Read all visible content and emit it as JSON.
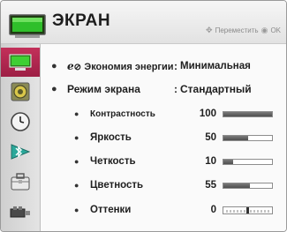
{
  "header": {
    "title": "ЭКРАН",
    "hint_move": "Переместить",
    "hint_ok": "OK"
  },
  "sidebar": {
    "items": [
      {
        "name": "picture",
        "icon": "monitor-icon",
        "active": true
      },
      {
        "name": "audio",
        "icon": "speaker-icon",
        "active": false
      },
      {
        "name": "time",
        "icon": "clock-icon",
        "active": false
      },
      {
        "name": "bluetooth",
        "icon": "bluetooth-icon",
        "active": false
      },
      {
        "name": "options",
        "icon": "briefcase-icon",
        "active": false
      },
      {
        "name": "input",
        "icon": "cable-icon",
        "active": false
      }
    ]
  },
  "settings": {
    "energy_prefix": "e",
    "energy_label": "Экономия энергии",
    "energy_value": "Минимальная",
    "mode_label": "Режим экрана",
    "mode_value": "Стандартный",
    "colon": ":",
    "adjustments": [
      {
        "label": "Контрастность",
        "value": "100",
        "level": 1.0
      },
      {
        "label": "Яркость",
        "value": "50",
        "level": 0.5
      },
      {
        "label": "Четкость",
        "value": "10",
        "level": 0.2
      },
      {
        "label": "Цветность",
        "value": "55",
        "level": 0.55
      },
      {
        "label": "Оттенки",
        "value": "0",
        "level": 0.5
      }
    ]
  },
  "colors": {
    "active_tab": "#b52a52",
    "bar_fill": "#5a5a5a"
  }
}
